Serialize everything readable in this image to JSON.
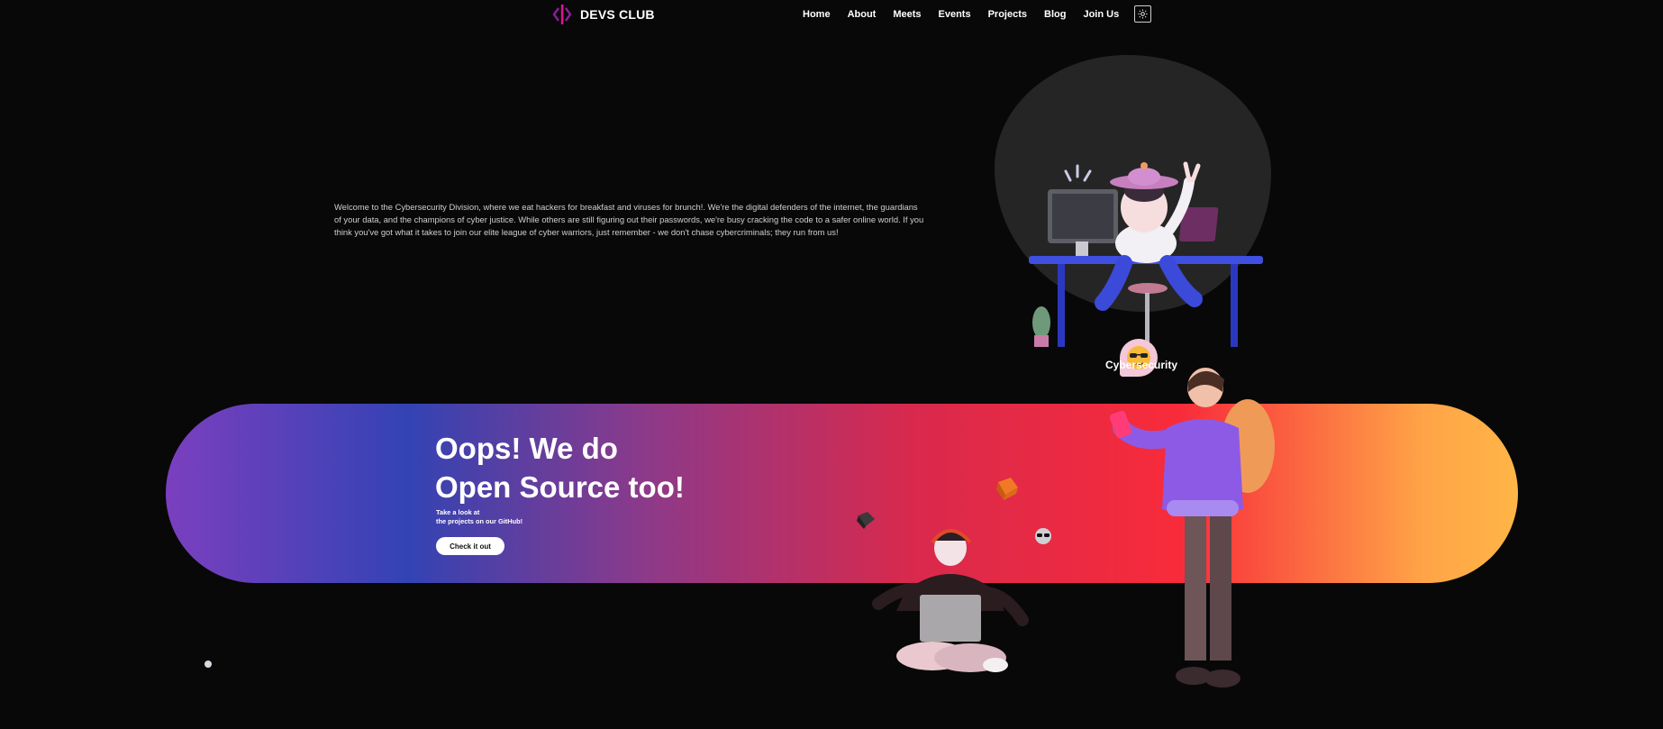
{
  "brand": {
    "name": "DEVS CLUB"
  },
  "nav": {
    "items": [
      "Home",
      "About",
      "Meets",
      "Events",
      "Projects",
      "Blog",
      "Join Us"
    ],
    "theme_toggle_icon": "sun-icon"
  },
  "intro": {
    "text": "Welcome to the Cybersecurity Division, where we eat hackers for breakfast and viruses for brunch!. We're the digital defenders of the internet, the guardians of your data, and the champions of cyber justice. While others are still figuring out their passwords, we're busy cracking the code to a safer online world. If you think you've got what it takes to join our elite league of cyber warriors, just remember - we don't chase cybercriminals; they run from us!"
  },
  "hero": {
    "caption": "Cybersecurity"
  },
  "banner": {
    "title_line1": "Oops! We do",
    "title_line2": "Open Source too!",
    "sub_line1": "Take a look at",
    "sub_line2": "the projects on our GitHub!",
    "button_label": "Check it out"
  },
  "colors": {
    "background": "#080808",
    "accent": "#c2138c",
    "gradient": [
      "#7b3fbf",
      "#3343b4",
      "#d8294d",
      "#f82b3a",
      "#ffb547"
    ]
  }
}
